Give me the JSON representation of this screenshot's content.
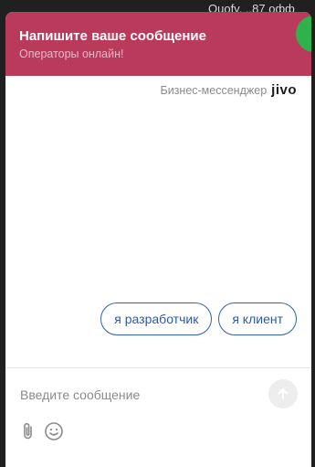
{
  "background": {
    "text": "Ouofy. ..87 офф"
  },
  "header": {
    "title": "Напишите ваше сообщение",
    "subtitle": "Операторы онлайн!",
    "color": "#b93a5a"
  },
  "branding": {
    "label": "Бизнес-мессенджер",
    "logo_text": "jivo"
  },
  "quick_replies": [
    {
      "label": "я разработчик"
    },
    {
      "label": "я клиент"
    }
  ],
  "composer": {
    "placeholder": "Введите сообщение",
    "value": "",
    "send_icon": "arrow-up-icon",
    "attach_icon": "paperclip-icon",
    "emoji_icon": "smiley-icon"
  }
}
